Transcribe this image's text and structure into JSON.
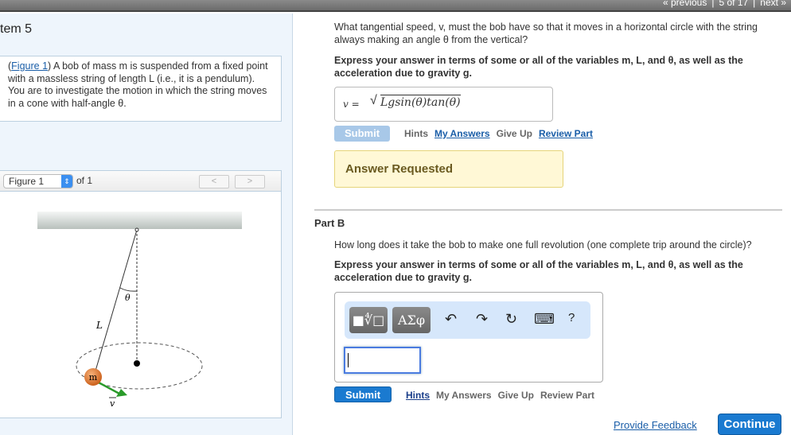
{
  "nav": {
    "previous": "« previous",
    "position": "5 of 17",
    "next": "next »"
  },
  "item_title": "tem 5",
  "intro": {
    "figure_link": "Figure 1",
    "text": ") A bob of mass m is suspended from a fixed point with a massless string of length L (i.e., it is a pendulum). You are to investigate the motion in which the string moves in a cone with half-angle θ."
  },
  "figure": {
    "select": "Figure 1",
    "of": "of 1",
    "prev": "<",
    "next": ">",
    "labels": {
      "theta": "θ",
      "L": "L",
      "m": "m",
      "v": "v"
    }
  },
  "partA": {
    "question": "What tangential speed, v, must the bob have so that it moves in a horizontal circle with the string always making an angle θ from the vertical?",
    "express": "Express your answer in terms of some or all of the variables m, L, and θ, as well as the acceleration due to gravity g.",
    "var": "v =",
    "answer": "Lgsin(θ)tan(θ)",
    "submit": "Submit",
    "hints": "Hints",
    "my_answers": "My Answers",
    "give_up": "Give Up",
    "review": "Review Part",
    "status": "Answer Requested"
  },
  "partB": {
    "title": "Part B",
    "question": "How long does it take the bob to make one full revolution (one complete trip around the circle)?",
    "express": "Express your answer in terms of some or all of the variables m, L, and θ, as well as the acceleration due to gravity g.",
    "tools": {
      "templates": "■∜□",
      "greek": "ΑΣφ",
      "undo": "↶",
      "redo": "↷",
      "reset": "↻",
      "keyboard": "⌨",
      "help": "?"
    },
    "answer": "",
    "submit": "Submit",
    "hints": "Hints",
    "my_answers": "My Answers",
    "give_up": "Give Up",
    "review": "Review Part"
  },
  "footer": {
    "feedback": "Provide Feedback",
    "continue": "Continue"
  }
}
